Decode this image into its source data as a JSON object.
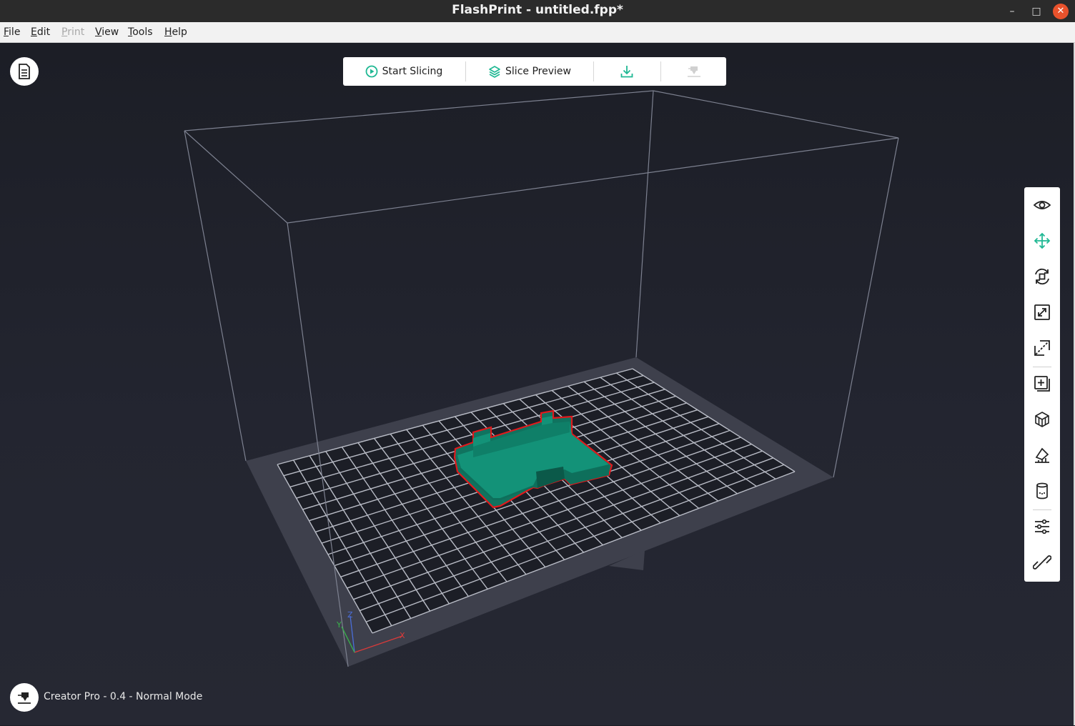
{
  "window": {
    "title": "FlashPrint - untitled.fpp*",
    "controls": {
      "minimize": "–",
      "maximize": "□",
      "close": "✕"
    }
  },
  "menubar": {
    "items": [
      {
        "label": "File",
        "enabled": true
      },
      {
        "label": "Edit",
        "enabled": true
      },
      {
        "label": "Print",
        "enabled": false
      },
      {
        "label": "View",
        "enabled": true
      },
      {
        "label": "Tools",
        "enabled": true
      },
      {
        "label": "Help",
        "enabled": true
      }
    ]
  },
  "toolbar": {
    "start_slicing_label": "Start Slicing",
    "slice_preview_label": "Slice Preview",
    "accent": "#1fb893"
  },
  "side_panel": {
    "tools": [
      {
        "icon": "eye-icon",
        "active": false
      },
      {
        "icon": "move-icon",
        "active": true
      },
      {
        "icon": "rotate-icon",
        "active": false
      },
      {
        "icon": "scale-icon",
        "active": false
      },
      {
        "icon": "cut-icon",
        "active": false
      },
      {
        "icon": "add-model-icon",
        "active": false
      },
      {
        "icon": "supports-icon",
        "active": false
      },
      {
        "icon": "place-on-face-icon",
        "active": false
      },
      {
        "icon": "raft-icon",
        "active": false
      },
      {
        "icon": "settings-sliders-icon",
        "active": false
      },
      {
        "icon": "link-icon",
        "active": false
      }
    ]
  },
  "status": {
    "printer_label": "Creator Pro - 0.4 - Normal Mode"
  },
  "scene": {
    "model_color": "#12876f",
    "model_outline": "#e0191c",
    "plate_color": "#3e404c",
    "axis_labels": {
      "x": "X",
      "y": "Y",
      "z": "Z"
    }
  }
}
